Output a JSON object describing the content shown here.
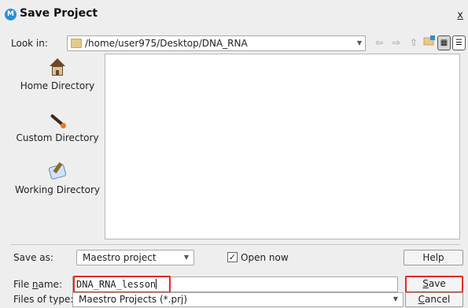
{
  "window": {
    "app_icon": "M",
    "title": "Save Project",
    "close_label": "x"
  },
  "toolbar": {
    "look_in_label": "Look in:",
    "look_in_path": "/home/user975/Desktop/DNA_RNA",
    "icons": [
      "back-icon",
      "forward-icon",
      "up-folder-icon",
      "new-folder-icon",
      "icon-view-icon",
      "list-view-icon"
    ]
  },
  "places": [
    {
      "label": "Home Directory",
      "icon": "home-icon"
    },
    {
      "label": "Custom Directory",
      "icon": "magic-wand-icon"
    },
    {
      "label": "Working Directory",
      "icon": "working-dir-icon"
    }
  ],
  "options": {
    "save_as_label": "Save as:",
    "save_as_value": "Maestro project",
    "open_now_label": "Open now",
    "open_now_checked": true,
    "help_label": "Help"
  },
  "file": {
    "name_label_pre": "File ",
    "name_label_key": "n",
    "name_label_post": "ame:",
    "name_value": "DNA_RNA_lesson",
    "type_label": "Files of type:",
    "type_value": "Maestro Projects (*.prj)",
    "save_key": "S",
    "save_rest": "ave",
    "cancel_key": "C",
    "cancel_rest": "ancel"
  },
  "colors": {
    "highlight": "#e52b1f",
    "accent": "#2a8fd6"
  }
}
